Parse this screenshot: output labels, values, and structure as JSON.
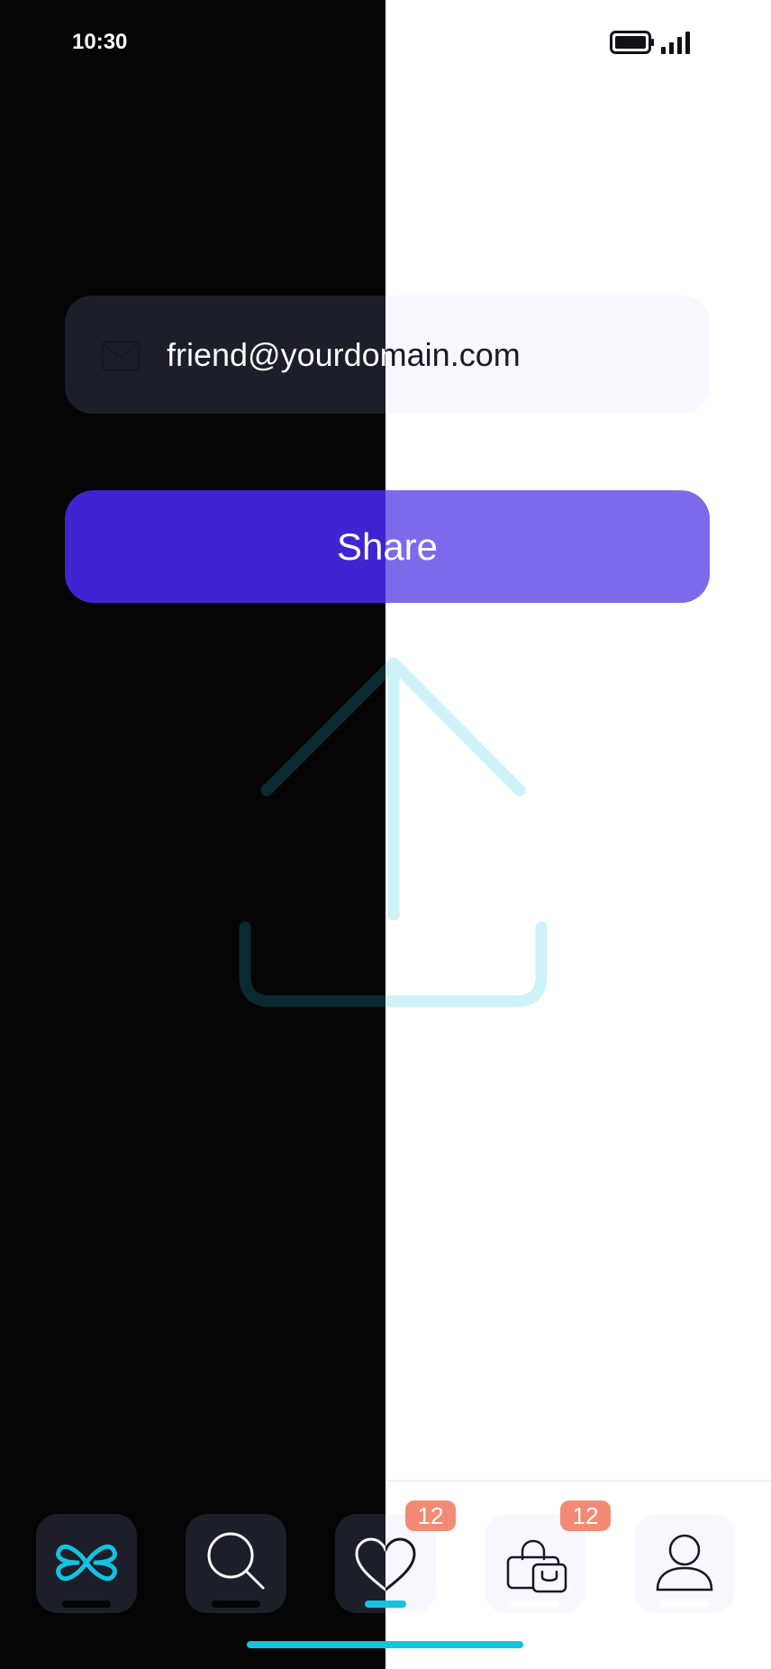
{
  "status_bar": {
    "time": "10:30",
    "battery_icon": "battery-full-icon",
    "signal_icon": "cellular-signal-icon"
  },
  "email_field": {
    "value": "friend@yourdomain.com",
    "icon": "mail-icon"
  },
  "share_button": {
    "label": "Share"
  },
  "illustration": {
    "icon": "upload-icon"
  },
  "tab_bar": {
    "tabs": [
      {
        "name": "home",
        "icon": "app-logo-icon",
        "active": false
      },
      {
        "name": "search",
        "icon": "search-icon",
        "active": false
      },
      {
        "name": "favorites",
        "icon": "heart-icon",
        "active": true,
        "badge": "12"
      },
      {
        "name": "cart",
        "icon": "shopping-bag-icon",
        "active": false,
        "badge": "12"
      },
      {
        "name": "profile",
        "icon": "user-icon",
        "active": false
      }
    ]
  },
  "colors": {
    "accent": "#13c3e2",
    "primary_dark": "#4024d1",
    "primary_light": "#7d6aeb",
    "badge": "#f28a75",
    "dark_background": "#050505",
    "light_background": "#ffffff"
  }
}
